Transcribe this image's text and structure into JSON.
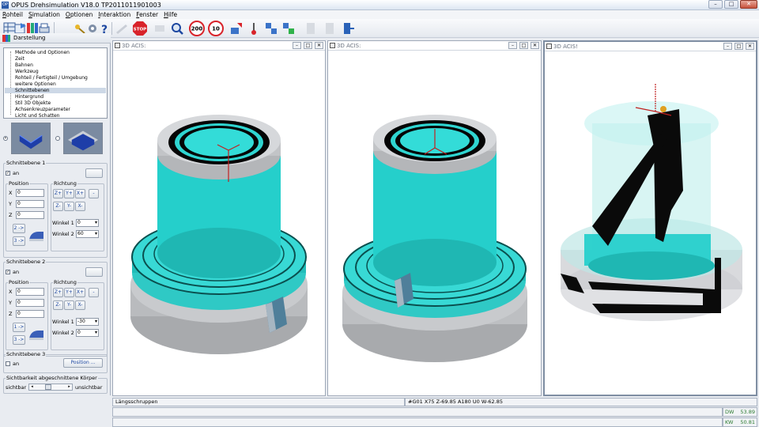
{
  "window": {
    "title": "OPUS Drehsimulation V18.0   TP2011011901003",
    "app_icon": "OP"
  },
  "menu": [
    "Rohteil",
    "Simulation",
    "Optionen",
    "Interaktion",
    "Fenster",
    "Hilfe"
  ],
  "toolbar": {
    "stop_label": "STOP",
    "zoom_200": "200",
    "zoom_10": "10"
  },
  "left_panel": {
    "title": "Darstellung",
    "tree": [
      "Methode und Optionen",
      "Zeit",
      "Bahnen",
      "Werkzeug",
      "Rohteil / Fertigteil / Umgebung",
      "weitere Optionen",
      "Schnittebenen",
      "Hintergrund",
      "Stil 3D Objekte",
      "Achsenkreuzparameter",
      "Licht und Schatten"
    ],
    "tree_selected": "Schnittebenen",
    "plane1": {
      "title": "Schnittebene 1",
      "on_label": "an",
      "position_label": "Position",
      "direction_label": "Richtung",
      "x_label": "X",
      "y_label": "Y",
      "z_label": "Z",
      "x": "0",
      "y": "0",
      "z": "0",
      "btn_zp": "Z+",
      "btn_yp": "Y+",
      "btn_xp": "X+",
      "btn_minus": "-",
      "btn_zm": "Z-",
      "btn_ym": "Y-",
      "btn_xm": "X-",
      "angle1_label": "Winkel 1",
      "angle1": "0",
      "angle2_label": "Winkel 2",
      "angle2": "60",
      "arrow_2": "2 ->",
      "arrow_3": "3 ->"
    },
    "plane2": {
      "title": "Schnittebene 2",
      "on_label": "an",
      "position_label": "Position",
      "direction_label": "Richtung",
      "x_label": "X",
      "y_label": "Y",
      "z_label": "Z",
      "x": "0",
      "y": "0",
      "z": "0",
      "btn_zp": "Z+",
      "btn_yp": "Y+",
      "btn_xp": "X+",
      "btn_minus": "-",
      "btn_zm": "Z-",
      "btn_ym": "Y-",
      "btn_xm": "X-",
      "angle1_label": "Winkel 1",
      "angle1": "-30",
      "angle2_label": "Winkel 2",
      "angle2": "0",
      "arrow_1": "1 ->",
      "arrow_3": "3 ->"
    },
    "plane3": {
      "title": "Schnittebene 3",
      "on_label": "an",
      "position_button": "Position ..."
    },
    "visibility": {
      "title": "Sichtbarkeit abgeschnittene Körper",
      "left": "sichtbar",
      "right": "unsichtbar"
    }
  },
  "viewports": [
    {
      "title": "3D ACIS:"
    },
    {
      "title": "3D ACIS:"
    },
    {
      "title": "3D ACIS!"
    }
  ],
  "status": {
    "mode": "Längsschruppen",
    "nc_line": "#G01 X75 Z-69.85 A180 U0 W-62.85",
    "dw_label": "DW",
    "dw_value": "53.89",
    "kw_label": "KW",
    "kw_value": "50.81"
  },
  "colors": {
    "part_cyan": "#22d6d2",
    "part_gray": "#b7b9bc",
    "accent_blue": "#1d47a0"
  }
}
